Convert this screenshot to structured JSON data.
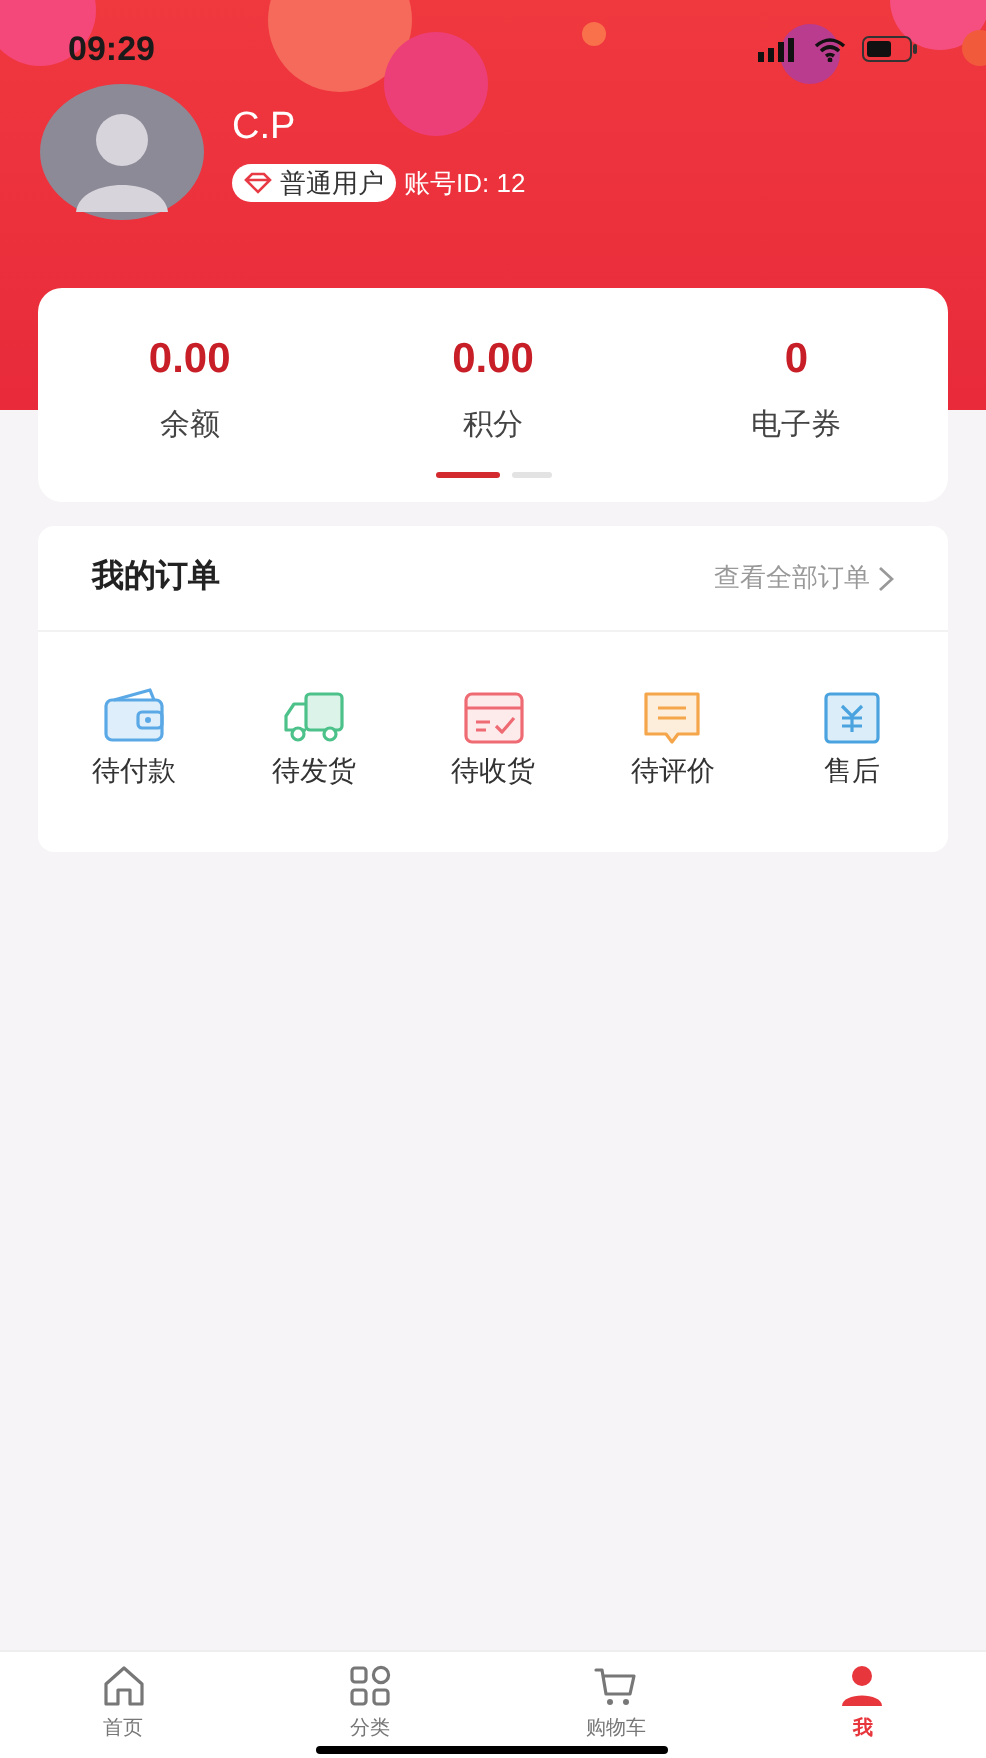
{
  "status_bar": {
    "time": "09:29"
  },
  "profile": {
    "name": "C.P",
    "badge": "普通用户",
    "account_id": "账号ID: 12"
  },
  "stats": [
    {
      "value": "0.00",
      "label": "余额"
    },
    {
      "value": "0.00",
      "label": "积分"
    },
    {
      "value": "0",
      "label": "电子券"
    }
  ],
  "pager": [
    {
      "selected": true
    },
    {
      "selected": false
    }
  ],
  "orders": {
    "title": "我的订单",
    "view_all": "查看全部订单",
    "items": [
      {
        "kind": "wallet",
        "label": "待付款",
        "color": "#5aa9e6"
      },
      {
        "kind": "truck",
        "label": "待发货",
        "color": "#4cc28a"
      },
      {
        "kind": "box",
        "label": "待收货",
        "color": "#ef6b73"
      },
      {
        "kind": "comment",
        "label": "待评价",
        "color": "#f5a54a"
      },
      {
        "kind": "refund",
        "label": "售后",
        "color": "#4aa3df"
      }
    ]
  },
  "tab_bar": [
    {
      "kind": "home",
      "label": "首页",
      "selected": false
    },
    {
      "kind": "category",
      "label": "分类",
      "selected": false
    },
    {
      "kind": "cart",
      "label": "购物车",
      "selected": false
    },
    {
      "kind": "user",
      "label": "我",
      "selected": true
    }
  ]
}
